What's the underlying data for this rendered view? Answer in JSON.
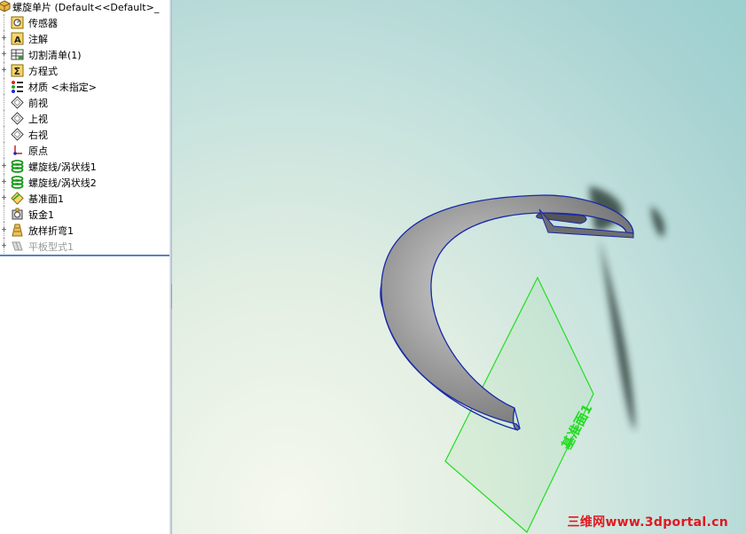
{
  "tree": {
    "root": {
      "label": "螺旋单片  (Default<<Default>_",
      "icon": "part-icon"
    },
    "items": [
      {
        "label": "传感器",
        "icon": "sensor-icon",
        "expandable": false
      },
      {
        "label": "注解",
        "icon": "annotation-icon",
        "expandable": true
      },
      {
        "label": "切割清单(1)",
        "icon": "cut-list-icon",
        "expandable": true
      },
      {
        "label": "方程式",
        "icon": "equation-icon",
        "expandable": true
      },
      {
        "label": "材质 <未指定>",
        "icon": "material-icon",
        "expandable": false
      },
      {
        "label": "前视",
        "icon": "plane-icon",
        "expandable": false
      },
      {
        "label": "上视",
        "icon": "plane-icon",
        "expandable": false
      },
      {
        "label": "右视",
        "icon": "plane-icon",
        "expandable": false
      },
      {
        "label": "原点",
        "icon": "origin-icon",
        "expandable": false
      },
      {
        "label": "螺旋线/涡状线1",
        "icon": "helix-icon",
        "expandable": true
      },
      {
        "label": "螺旋线/涡状线2",
        "icon": "helix-icon",
        "expandable": true
      },
      {
        "label": "基准面1",
        "icon": "ref-plane-icon",
        "expandable": true
      },
      {
        "label": "钣金1",
        "icon": "sheet-metal-icon",
        "expandable": false
      },
      {
        "label": "放样折弯1",
        "icon": "lofted-bend-icon",
        "expandable": true
      },
      {
        "label": "平板型式1",
        "icon": "flat-pattern-icon",
        "expandable": true,
        "suppressed": true
      }
    ]
  },
  "viewport": {
    "plane_label": "基准面1",
    "plane_color": "#22dd22",
    "part_color": "#8a8a8a",
    "edge_color": "#1a2aa8"
  },
  "watermark": "三维网www.3dportal.cn"
}
